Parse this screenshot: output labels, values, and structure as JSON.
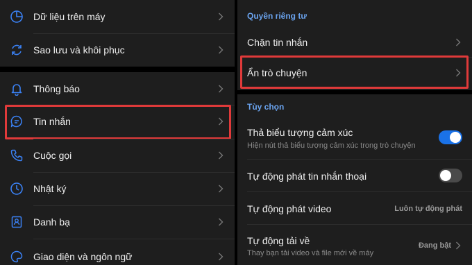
{
  "left": {
    "items": [
      {
        "label": "Dữ liệu trên máy",
        "icon": "pie-chart-icon"
      },
      {
        "label": "Sao lưu và khôi phục",
        "icon": "sync-icon"
      },
      {
        "label": "Thông báo",
        "icon": "bell-icon"
      },
      {
        "label": "Tin nhắn",
        "icon": "chat-bubble-icon"
      },
      {
        "label": "Cuộc gọi",
        "icon": "phone-icon"
      },
      {
        "label": "Nhật ký",
        "icon": "clock-icon"
      },
      {
        "label": "Danh bạ",
        "icon": "contact-book-icon"
      },
      {
        "label": "Giao diện và ngôn ngữ",
        "icon": "palette-icon"
      }
    ]
  },
  "right": {
    "privacy_section": "Quyền riêng tư",
    "block_messages": "Chặn tin nhắn",
    "hide_chats": "Ẩn trò chuyện",
    "options_section": "Tùy chọn",
    "reactions": {
      "label": "Thả biểu tượng cảm xúc",
      "description": "Hiện nút thả biểu tượng cảm xúc trong trò chuyện",
      "enabled": true
    },
    "auto_voice": {
      "label": "Tự động phát tin nhắn thoại",
      "enabled": false
    },
    "auto_video": {
      "label": "Tự động phát video",
      "value": "Luôn tự động phát"
    },
    "auto_download": {
      "label": "Tự động tải về",
      "description": "Thay bạn tải video và file mới về máy",
      "value": "Đang bật"
    }
  },
  "colors": {
    "accent": "#1a72e8",
    "highlight": "#e03a3a",
    "section": "#6aa3ee"
  }
}
